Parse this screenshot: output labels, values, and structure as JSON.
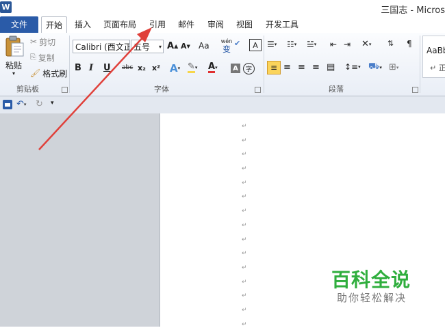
{
  "window": {
    "app_icon": "W",
    "title": "三国志 - Micros"
  },
  "tabs": [
    {
      "label": "文件"
    },
    {
      "label": "开始"
    },
    {
      "label": "插入"
    },
    {
      "label": "页面布局"
    },
    {
      "label": "引用"
    },
    {
      "label": "邮件"
    },
    {
      "label": "审阅"
    },
    {
      "label": "视图"
    },
    {
      "label": "开发工具"
    }
  ],
  "clipboard": {
    "paste": "粘贴",
    "cut": "剪切",
    "copy": "复制",
    "format_painter": "格式刷",
    "label": "剪贴板"
  },
  "font": {
    "font_name": "Calibri (西文正",
    "font_size": "五号",
    "grow": "A",
    "shrink": "A",
    "change_case": "Aa",
    "bold": "B",
    "italic": "I",
    "underline": "U",
    "strikethrough": "abc",
    "subscript": "x₂",
    "superscript": "x²",
    "phonetic_top": "wén",
    "phonetic_bottom": "变",
    "border_char": "A",
    "shade_char": "A",
    "circle_char": "字",
    "label": "字体"
  },
  "paragraph": {
    "label": "段落"
  },
  "styles": {
    "sample": "AaBb",
    "sample_sub": "↵ 正"
  },
  "watermark": {
    "title": "百科全说",
    "subtitle": "助你轻松解决"
  },
  "colors": {
    "file_tab": "#2a5ba8",
    "arrow": "#e0403a",
    "watermark": "#2fae3d",
    "highlight": "#f7d64a",
    "font_color": "#e03030"
  }
}
